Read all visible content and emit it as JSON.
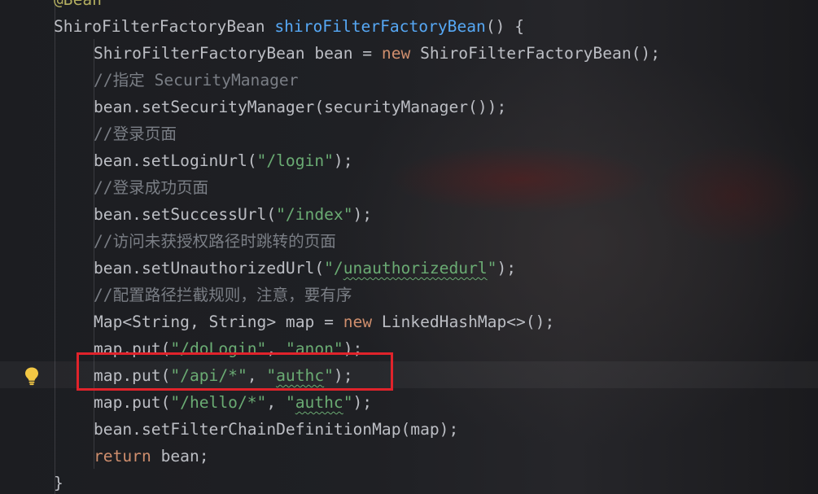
{
  "editor": {
    "language": "java",
    "highlighted_line_index": 14,
    "lines": [
      {
        "indent": 1,
        "segments": [
          {
            "text": "@Bean",
            "class": "an"
          }
        ]
      },
      {
        "indent": 1,
        "segments": [
          {
            "text": "ShiroFilterFactoryBean "
          },
          {
            "text": "shiroFilterFactoryBean",
            "class": "fn"
          },
          {
            "text": "() {"
          }
        ]
      },
      {
        "indent": 2,
        "segments": [
          {
            "text": "ShiroFilterFactoryBean bean = "
          },
          {
            "text": "new",
            "class": "kw"
          },
          {
            "text": " ShiroFilterFactoryBean();"
          }
        ]
      },
      {
        "indent": 2,
        "segments": [
          {
            "text": "//指定 SecurityManager",
            "class": "cm"
          }
        ]
      },
      {
        "indent": 2,
        "segments": [
          {
            "text": "bean.setSecurityManager(securityManager());"
          }
        ]
      },
      {
        "indent": 2,
        "segments": [
          {
            "text": "//登录页面",
            "class": "cm"
          }
        ]
      },
      {
        "indent": 2,
        "segments": [
          {
            "text": "bean.setLoginUrl("
          },
          {
            "text": "\"/login\"",
            "class": "str"
          },
          {
            "text": ");"
          }
        ]
      },
      {
        "indent": 2,
        "segments": [
          {
            "text": "//登录成功页面",
            "class": "cm"
          }
        ]
      },
      {
        "indent": 2,
        "segments": [
          {
            "text": "bean.setSuccessUrl("
          },
          {
            "text": "\"/index\"",
            "class": "str"
          },
          {
            "text": ");"
          }
        ]
      },
      {
        "indent": 2,
        "segments": [
          {
            "text": "//访问未获授权路径时跳转的页面",
            "class": "cm"
          }
        ]
      },
      {
        "indent": 2,
        "segments": [
          {
            "text": "bean.setUnauthorizedUrl("
          },
          {
            "text": "\"/",
            "class": "str"
          },
          {
            "text": "unauthorizedurl",
            "class": "str wavy"
          },
          {
            "text": "\"",
            "class": "str"
          },
          {
            "text": ");"
          }
        ]
      },
      {
        "indent": 2,
        "segments": [
          {
            "text": "//配置路径拦截规则，注意，要有序",
            "class": "cm"
          }
        ]
      },
      {
        "indent": 2,
        "segments": [
          {
            "text": "Map<String, String> map = "
          },
          {
            "text": "new",
            "class": "kw"
          },
          {
            "text": " LinkedHashMap<>();"
          }
        ]
      },
      {
        "indent": 2,
        "segments": [
          {
            "text": "map.put("
          },
          {
            "text": "\"/doLogin\"",
            "class": "str"
          },
          {
            "text": ", "
          },
          {
            "text": "\"anon\"",
            "class": "str"
          },
          {
            "text": ");"
          }
        ]
      },
      {
        "indent": 2,
        "segments": [
          {
            "text": "map.put("
          },
          {
            "text": "\"/api/*\"",
            "class": "str"
          },
          {
            "text": ", "
          },
          {
            "text": "\"",
            "class": "str"
          },
          {
            "text": "authc",
            "class": "str wavy"
          },
          {
            "text": "\"",
            "class": "str"
          },
          {
            "text": ");"
          }
        ]
      },
      {
        "indent": 2,
        "segments": [
          {
            "text": "map.put("
          },
          {
            "text": "\"/hello/*\"",
            "class": "str"
          },
          {
            "text": ", "
          },
          {
            "text": "\"",
            "class": "str"
          },
          {
            "text": "authc",
            "class": "str wavy"
          },
          {
            "text": "\"",
            "class": "str"
          },
          {
            "text": ");"
          }
        ]
      },
      {
        "indent": 2,
        "segments": [
          {
            "text": "bean.setFilterChainDefinitionMap(map);"
          }
        ]
      },
      {
        "indent": 2,
        "segments": [
          {
            "text": "return",
            "class": "kw"
          },
          {
            "text": " bean;"
          }
        ]
      },
      {
        "indent": 1,
        "segments": [
          {
            "text": "}"
          }
        ]
      }
    ]
  },
  "gutter": {
    "icon": "lightbulb-icon",
    "icon_color": "#f2c744"
  },
  "annotation": {
    "shape": "red-rectangle",
    "color": "#e0232b",
    "marks_line_index": 14
  },
  "colors": {
    "background": "#1e1f22",
    "default_text": "#bcbec4",
    "keyword": "#cf8e6d",
    "string": "#6aab73",
    "method_declaration": "#56a8f5",
    "comment": "#7a7e85",
    "annotation": "#b3ae60"
  }
}
